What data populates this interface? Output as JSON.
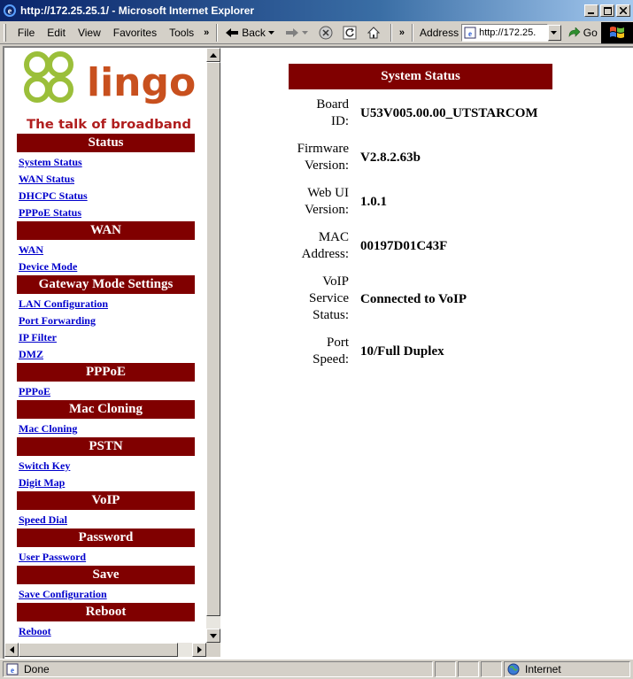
{
  "window": {
    "title": "http://172.25.25.1/ - Microsoft Internet Explorer"
  },
  "menu": {
    "items": [
      "File",
      "Edit",
      "View",
      "Favorites",
      "Tools"
    ],
    "overflow": "»"
  },
  "toolbar": {
    "back_label": "Back",
    "overflow": "»",
    "address_label": "Address",
    "address_value": "http://172.25.",
    "go_label": "Go"
  },
  "logo": {
    "brand": "lingo",
    "tagline": "The talk of broadband"
  },
  "nav": {
    "sections": [
      {
        "title": "Status",
        "links": [
          "System Status",
          "WAN Status",
          "DHCPC Status",
          "PPPoE Status"
        ]
      },
      {
        "title": "WAN",
        "links": [
          "WAN",
          "Device Mode"
        ]
      },
      {
        "title": "Gateway Mode Settings",
        "links": [
          "LAN Configuration",
          "Port Forwarding",
          "IP Filter",
          "DMZ"
        ]
      },
      {
        "title": "PPPoE",
        "links": [
          "PPPoE"
        ]
      },
      {
        "title": "Mac Cloning",
        "links": [
          "Mac Cloning"
        ]
      },
      {
        "title": "PSTN",
        "links": [
          "Switch Key",
          "Digit Map"
        ]
      },
      {
        "title": "VoIP",
        "links": [
          "Speed Dial"
        ]
      },
      {
        "title": "Password",
        "links": [
          "User Password"
        ]
      },
      {
        "title": "Save",
        "links": [
          "Save Configuration"
        ]
      },
      {
        "title": "Reboot",
        "links": [
          "Reboot"
        ]
      }
    ]
  },
  "system_status": {
    "title": "System Status",
    "rows": [
      {
        "label_lines": [
          "Board",
          "ID:"
        ],
        "value": "U53V005.00.00_UTSTARCOM"
      },
      {
        "label_lines": [
          "Firmware",
          "Version:"
        ],
        "value": "V2.8.2.63b"
      },
      {
        "label_lines": [
          "Web UI",
          "Version:"
        ],
        "value": "1.0.1"
      },
      {
        "label_lines": [
          "MAC",
          "Address:"
        ],
        "value": "00197D01C43F"
      },
      {
        "label_lines": [
          "VoIP",
          "Service",
          "Status:"
        ],
        "value": "Connected to VoIP"
      },
      {
        "label_lines": [
          "Port",
          "Speed:"
        ],
        "value": "10/Full Duplex"
      }
    ]
  },
  "statusbar": {
    "status_text": "Done",
    "zone_text": "Internet"
  },
  "colors": {
    "header_bg": "#800000",
    "link": "#0000cc",
    "logo_orange": "#c8501e",
    "logo_green": "#9bbf3a",
    "tagline_red": "#b01e1e"
  }
}
